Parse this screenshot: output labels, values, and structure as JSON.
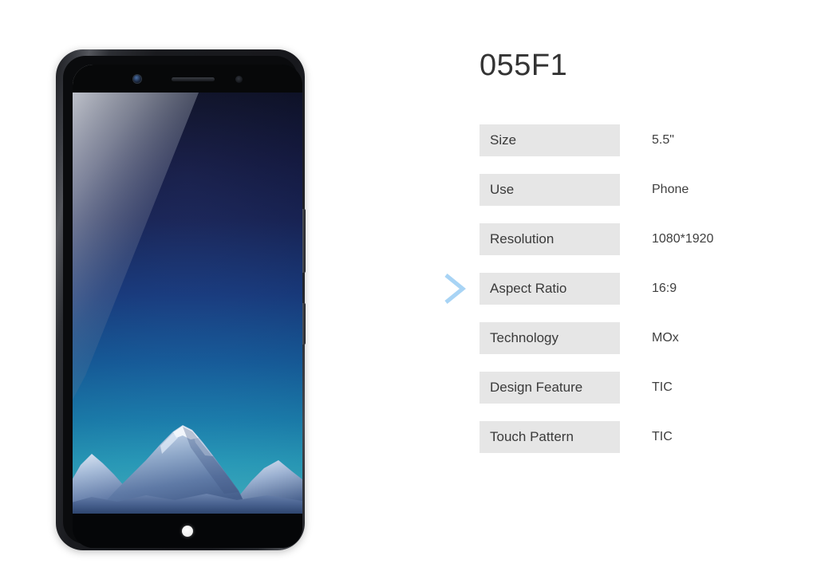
{
  "background_color": "#ffffff",
  "product": {
    "title": "055F1"
  },
  "specs": {
    "rows": [
      {
        "label": "Size",
        "value": "5.5\""
      },
      {
        "label": "Use",
        "value": "Phone"
      },
      {
        "label": "Resolution",
        "value": "1080*1920"
      },
      {
        "label": "Aspect Ratio",
        "value": "16:9"
      },
      {
        "label": "Technology",
        "value": "MOx"
      },
      {
        "label": "Design Feature",
        "value": "TIC"
      },
      {
        "label": "Touch Pattern",
        "value": "TIC"
      }
    ],
    "label_background": "#e6e6e6",
    "label_text_color": "#3a3a3a",
    "value_text_color": "#3f3f3f",
    "marker_row_index": 3,
    "marker_icon": "chevron-right-icon",
    "marker_color": "#a8d4f5"
  },
  "phone": {
    "name": "smartphone-product-image",
    "frame_color": "#1b1c20",
    "screen_wallpaper": "snowy-mountain-blue-sky",
    "wallpaper_sky_top_color": "#0a0e26",
    "wallpaper_sky_bottom_color": "#4fd0e4",
    "components": [
      {
        "name": "front-camera-icon"
      },
      {
        "name": "earpiece-speaker-icon"
      },
      {
        "name": "proximity-sensor-icon"
      },
      {
        "name": "home-button-indicator"
      },
      {
        "name": "volume-button"
      },
      {
        "name": "power-button"
      }
    ]
  }
}
